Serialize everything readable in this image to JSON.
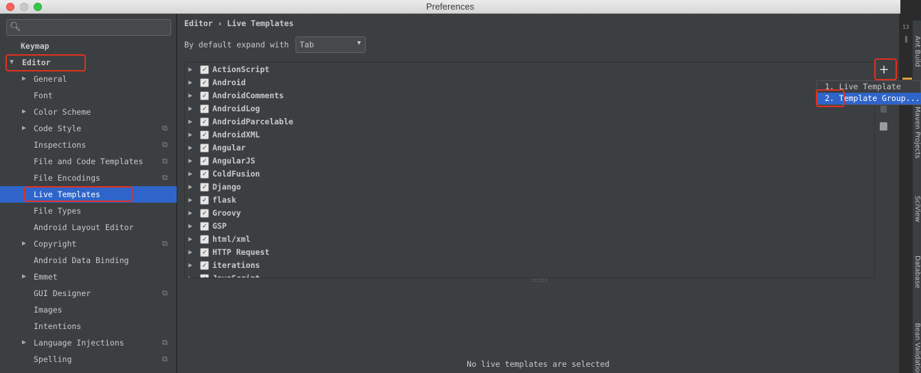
{
  "window": {
    "title": "Preferences"
  },
  "search": {
    "placeholder": ""
  },
  "sidebar": {
    "items": [
      {
        "label": "Keymap",
        "level": 0,
        "expandable": false,
        "copyable": false
      },
      {
        "label": "Editor",
        "level": 0,
        "expandable": true,
        "expanded": true,
        "copyable": false
      },
      {
        "label": "General",
        "level": 1,
        "expandable": true,
        "copyable": false
      },
      {
        "label": "Font",
        "level": 1,
        "expandable": false,
        "copyable": false
      },
      {
        "label": "Color Scheme",
        "level": 1,
        "expandable": true,
        "copyable": false
      },
      {
        "label": "Code Style",
        "level": 1,
        "expandable": true,
        "copyable": true
      },
      {
        "label": "Inspections",
        "level": 1,
        "expandable": false,
        "copyable": true
      },
      {
        "label": "File and Code Templates",
        "level": 1,
        "expandable": false,
        "copyable": true
      },
      {
        "label": "File Encodings",
        "level": 1,
        "expandable": false,
        "copyable": true
      },
      {
        "label": "Live Templates",
        "level": 1,
        "expandable": false,
        "copyable": false,
        "selected": true
      },
      {
        "label": "File Types",
        "level": 1,
        "expandable": false,
        "copyable": false
      },
      {
        "label": "Android Layout Editor",
        "level": 1,
        "expandable": false,
        "copyable": false
      },
      {
        "label": "Copyright",
        "level": 1,
        "expandable": true,
        "copyable": true
      },
      {
        "label": "Android Data Binding",
        "level": 1,
        "expandable": false,
        "copyable": false
      },
      {
        "label": "Emmet",
        "level": 1,
        "expandable": true,
        "copyable": false
      },
      {
        "label": "GUI Designer",
        "level": 1,
        "expandable": false,
        "copyable": true
      },
      {
        "label": "Images",
        "level": 1,
        "expandable": false,
        "copyable": false
      },
      {
        "label": "Intentions",
        "level": 1,
        "expandable": false,
        "copyable": false
      },
      {
        "label": "Language Injections",
        "level": 1,
        "expandable": true,
        "copyable": true
      },
      {
        "label": "Spelling",
        "level": 1,
        "expandable": false,
        "copyable": true
      }
    ]
  },
  "main": {
    "breadcrumb": "Editor › Live Templates",
    "expand_label": "By default expand with",
    "expand_select": {
      "value": "Tab"
    },
    "template_groups": [
      {
        "name": "ActionScript",
        "checked": true
      },
      {
        "name": "Android",
        "checked": true
      },
      {
        "name": "AndroidComments",
        "checked": true
      },
      {
        "name": "AndroidLog",
        "checked": true
      },
      {
        "name": "AndroidParcelable",
        "checked": true
      },
      {
        "name": "AndroidXML",
        "checked": true
      },
      {
        "name": "Angular",
        "checked": true
      },
      {
        "name": "AngularJS",
        "checked": true
      },
      {
        "name": "ColdFusion",
        "checked": true
      },
      {
        "name": "Django",
        "checked": true
      },
      {
        "name": "flask",
        "checked": true
      },
      {
        "name": "Groovy",
        "checked": true
      },
      {
        "name": "GSP",
        "checked": true
      },
      {
        "name": "html/xml",
        "checked": true
      },
      {
        "name": "HTTP Request",
        "checked": true
      },
      {
        "name": "iterations",
        "checked": true
      },
      {
        "name": "JavaScript",
        "checked": true
      }
    ],
    "empty_message": "No live templates are selected"
  },
  "add_popup": {
    "items": [
      {
        "label": "1. Live Template",
        "selected": false
      },
      {
        "label": "2. Template Group...",
        "selected": true
      }
    ]
  },
  "ide_strip": {
    "line_number": "13",
    "tabs": [
      "Ant Build",
      "Maven Projects",
      "SciView",
      "Database",
      "Bean Validation"
    ]
  },
  "colors": {
    "selection": "#2f65ca",
    "panel": "#3c3f41",
    "highlight": "#e0321f"
  }
}
